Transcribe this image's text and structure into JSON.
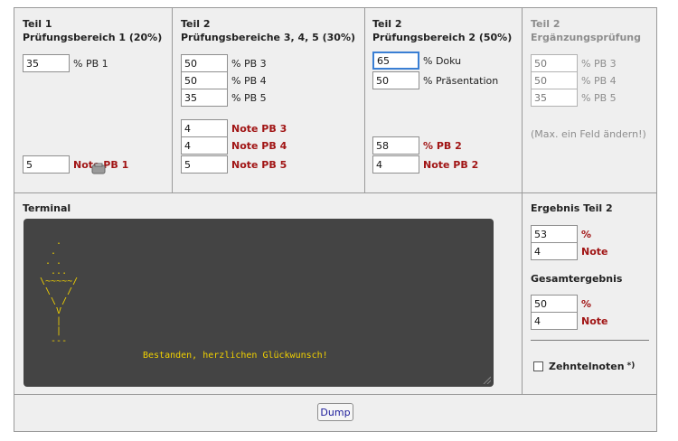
{
  "col1": {
    "title": "Teil 1",
    "subtitle": "Prüfungsbereich 1 (20%)",
    "pb1_percent": "35",
    "pb1_percent_label": "% PB 1",
    "pb1_note": "5",
    "pb1_note_label": "Note PB 1"
  },
  "col2": {
    "title": "Teil 2",
    "subtitle": "Prüfungsbereiche 3, 4, 5 (30%)",
    "percents": [
      {
        "value": "50",
        "label": "% PB 3"
      },
      {
        "value": "50",
        "label": "% PB 4"
      },
      {
        "value": "35",
        "label": "% PB 5"
      }
    ],
    "notes": [
      {
        "value": "4",
        "label": "Note PB 3"
      },
      {
        "value": "4",
        "label": "Note PB 4"
      },
      {
        "value": "5",
        "label": "Note PB 5"
      }
    ]
  },
  "col3": {
    "title": "Teil 2",
    "subtitle": "Prüfungsbereich 2 (50%)",
    "doku": "65",
    "doku_label": "% Doku",
    "praesentation": "50",
    "praesentation_label": "% Präsentation",
    "pb2_percent": "58",
    "pb2_percent_label": "% PB 2",
    "pb2_note": "4",
    "pb2_note_label": "Note PB 2"
  },
  "col4": {
    "title": "Teil 2",
    "subtitle": "Ergänzungsprüfung",
    "items": [
      {
        "value": "50",
        "label": "% PB 3"
      },
      {
        "value": "50",
        "label": "% PB 4"
      },
      {
        "value": "35",
        "label": "% PB 5"
      }
    ],
    "hint": "(Max. ein Feld ändern!)"
  },
  "terminal": {
    "title": "Terminal",
    "art": "   .\n  .\n . .\n  ...\n\\~~~~~/\n \\   /\n  \\ /\n   V\n   |\n   |\n  ---",
    "message": "Bestanden, herzlichen Glückwunsch!"
  },
  "results": {
    "teil2_title": "Ergebnis Teil 2",
    "teil2_percent": "53",
    "teil2_percent_label": "%",
    "teil2_note": "4",
    "teil2_note_label": "Note",
    "gesamt_title": "Gesamtergebnis",
    "gesamt_percent": "50",
    "gesamt_percent_label": "%",
    "gesamt_note": "4",
    "gesamt_note_label": "Note",
    "zehntel_label": "Zehntelnoten",
    "zehntel_mark": "*)"
  },
  "footer": {
    "dump_label": "Dump"
  },
  "colors": {
    "accent_red": "#a11515",
    "terminal_bg": "#444444",
    "terminal_text": "#f0d000",
    "focus": "#3a7fd4"
  }
}
